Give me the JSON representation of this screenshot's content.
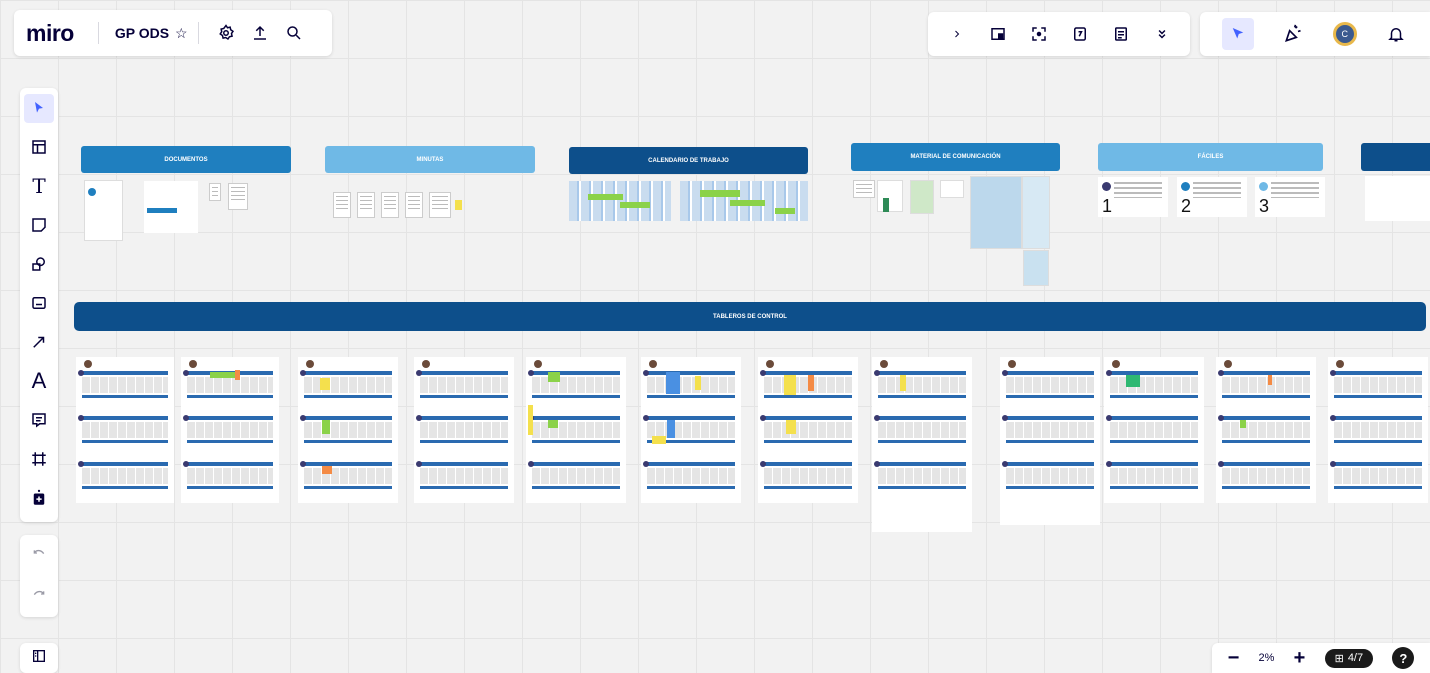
{
  "app": {
    "logo": "miro",
    "board_name": "GP ODS",
    "star": "☆"
  },
  "top_icons": [
    "settings-icon",
    "share-icon",
    "search-icon"
  ],
  "right_toolbar": [
    "chevron-right-icon",
    "card-icon",
    "focus-icon",
    "timer-icon",
    "notes-icon",
    "more-icon"
  ],
  "right_toolbar2": [
    "cursor-filter-icon",
    "reactions-icon",
    "avatar",
    "bell-icon"
  ],
  "avatar_initial": "C",
  "left_tools": [
    "select",
    "templates",
    "text",
    "sticky",
    "shapes",
    "card",
    "connector",
    "pen",
    "comment",
    "frame",
    "add-apps"
  ],
  "left_tool_text": "T",
  "pen_glyph": "A",
  "zoom": {
    "minus": "−",
    "level": "2%",
    "plus": "+",
    "pages": "4/7",
    "help": "?"
  },
  "sections": [
    {
      "title": "DOCUMENTOS",
      "color": "#1f7fbf"
    },
    {
      "title": "MINUTAS",
      "color": "#6fb9e6"
    },
    {
      "title": "CALENDARIO DE TRABAJO",
      "color": "#0d4f8b"
    },
    {
      "title": "MATERIAL DE COMUNICACIÓN",
      "color": "#1f7fbf"
    },
    {
      "title": "FÁCILES",
      "color": "#6fb9e6"
    }
  ],
  "steps": [
    "1",
    "2",
    "3"
  ],
  "control_title": "TABLEROS DE CONTROL",
  "colors": {
    "dark_blue": "#0d4f8b",
    "mid_blue": "#1f7fbf",
    "light_blue": "#6fb9e6",
    "green": "#8bd249",
    "yellow": "#f4e04d",
    "accent": "#4262ff"
  }
}
